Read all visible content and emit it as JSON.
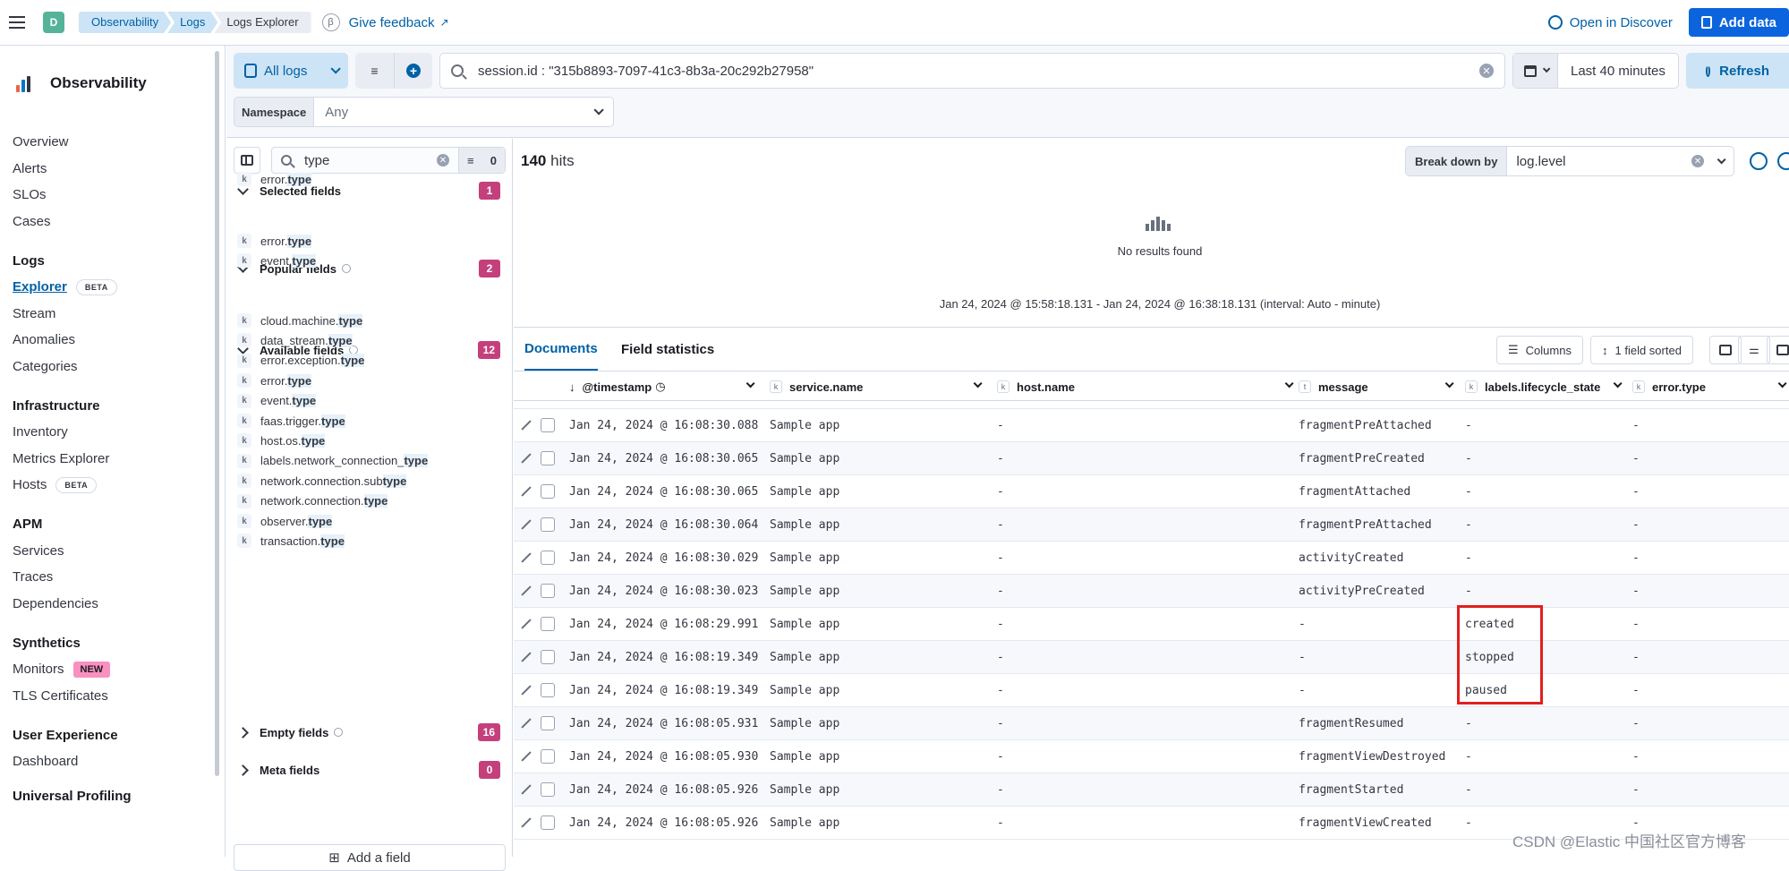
{
  "header": {
    "space_initial": "D",
    "breadcrumbs": [
      "Observability",
      "Logs",
      "Logs Explorer"
    ],
    "feedback_label": "Give feedback",
    "open_discover_label": "Open in Discover",
    "add_data_label": "Add data"
  },
  "nav": {
    "title": "Observability",
    "items_top": [
      "Overview",
      "Alerts",
      "SLOs",
      "Cases"
    ],
    "logs_group": "Logs",
    "logs_items": [
      "Explorer",
      "Stream",
      "Anomalies",
      "Categories"
    ],
    "beta_label": "BETA",
    "infra_group": "Infrastructure",
    "infra_items": [
      "Inventory",
      "Metrics Explorer",
      "Hosts"
    ],
    "apm_group": "APM",
    "apm_items": [
      "Services",
      "Traces",
      "Dependencies"
    ],
    "synth_group": "Synthetics",
    "synth_items": [
      "Monitors",
      "TLS Certificates"
    ],
    "new_label": "NEW",
    "ux_group": "User Experience",
    "ux_items": [
      "Dashboard"
    ],
    "profiling_group": "Universal Profiling"
  },
  "query": {
    "dataset_label": "All logs",
    "search_value": "session.id : \"315b8893-7097-41c3-8b3a-20c292b27958\"",
    "time_range": "Last 40 minutes",
    "refresh_label": "Refresh",
    "namespace_label": "Namespace",
    "namespace_value": "Any"
  },
  "fields": {
    "search_value": "type",
    "filter_count": "0",
    "token_label": "k",
    "selected": {
      "label": "Selected fields",
      "count": "1",
      "items": [
        [
          "error.",
          "type"
        ]
      ]
    },
    "popular": {
      "label": "Popular fields",
      "count": "2",
      "items": [
        [
          "error.",
          "type"
        ],
        [
          "event.",
          "type"
        ]
      ]
    },
    "available": {
      "label": "Available fields",
      "count": "12",
      "items": [
        [
          "cloud.machine.",
          "type"
        ],
        [
          "data_stream.",
          "type"
        ],
        [
          "error.exception.",
          "type"
        ],
        [
          "error.",
          "type"
        ],
        [
          "event.",
          "type"
        ],
        [
          "faas.trigger.",
          "type"
        ],
        [
          "host.os.",
          "type"
        ],
        [
          "labels.network_connection_",
          "type"
        ],
        [
          "network.connection.sub",
          "type"
        ],
        [
          "network.connection.",
          "type"
        ],
        [
          "observer.",
          "type"
        ],
        [
          "transaction.",
          "type"
        ]
      ]
    },
    "empty": {
      "label": "Empty fields",
      "count": "16"
    },
    "meta": {
      "label": "Meta fields",
      "count": "0"
    },
    "add_field_label": "Add a field"
  },
  "main": {
    "hits_count": "140",
    "hits_label": "hits",
    "breakdown_label": "Break down by",
    "breakdown_value": "log.level",
    "no_results": "No results found",
    "timespan": "Jan 24, 2024 @ 15:58:18.131 - Jan 24, 2024 @ 16:38:18.131 (interval: Auto - minute)",
    "tab_documents": "Documents",
    "tab_field_stats": "Field statistics",
    "columns_label": "Columns",
    "sorted_label": "1 field sorted"
  },
  "grid": {
    "headers": [
      "@timestamp",
      "service.name",
      "host.name",
      "message",
      "labels.lifecycle_state",
      "error.type"
    ],
    "tokens": [
      "k",
      "k",
      "t",
      "k",
      "k"
    ],
    "rows": [
      [
        "Jan 24, 2024 @ 16:08:30.088",
        "Sample app",
        "-",
        "fragmentPreAttached",
        "-",
        "-"
      ],
      [
        "Jan 24, 2024 @ 16:08:30.065",
        "Sample app",
        "-",
        "fragmentPreCreated",
        "-",
        "-"
      ],
      [
        "Jan 24, 2024 @ 16:08:30.065",
        "Sample app",
        "-",
        "fragmentAttached",
        "-",
        "-"
      ],
      [
        "Jan 24, 2024 @ 16:08:30.064",
        "Sample app",
        "-",
        "fragmentPreAttached",
        "-",
        "-"
      ],
      [
        "Jan 24, 2024 @ 16:08:30.029",
        "Sample app",
        "-",
        "activityCreated",
        "-",
        "-"
      ],
      [
        "Jan 24, 2024 @ 16:08:30.023",
        "Sample app",
        "-",
        "activityPreCreated",
        "-",
        "-"
      ],
      [
        "Jan 24, 2024 @ 16:08:29.991",
        "Sample app",
        "-",
        "-",
        "created",
        "-"
      ],
      [
        "Jan 24, 2024 @ 16:08:19.349",
        "Sample app",
        "-",
        "-",
        "stopped",
        "-"
      ],
      [
        "Jan 24, 2024 @ 16:08:19.349",
        "Sample app",
        "-",
        "-",
        "paused",
        "-"
      ],
      [
        "Jan 24, 2024 @ 16:08:05.931",
        "Sample app",
        "-",
        "fragmentResumed",
        "-",
        "-"
      ],
      [
        "Jan 24, 2024 @ 16:08:05.930",
        "Sample app",
        "-",
        "fragmentViewDestroyed",
        "-",
        "-"
      ],
      [
        "Jan 24, 2024 @ 16:08:05.926",
        "Sample app",
        "-",
        "fragmentStarted",
        "-",
        "-"
      ],
      [
        "Jan 24, 2024 @ 16:08:05.926",
        "Sample app",
        "-",
        "fragmentViewCreated",
        "-",
        "-"
      ]
    ]
  },
  "watermark": "CSDN @Elastic 中国社区官方博客",
  "colors": {
    "accent": "#0061a6",
    "primary_button": "#0b64dd",
    "count_badge": "#c4407c",
    "highlight_box": "#e02020"
  }
}
